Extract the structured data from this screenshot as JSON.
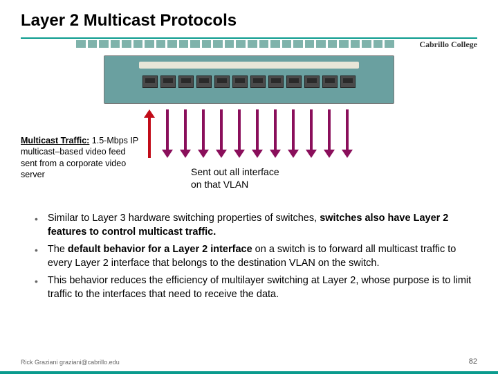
{
  "title": "Layer 2 Multicast Protocols",
  "brand": "Cabrillo College",
  "traffic": {
    "label": "Multicast Traffic:",
    "desc": " 1.5-Mbps IP multicast–based video feed sent from a corporate video server"
  },
  "sent_label_l1": "Sent out all interface",
  "sent_label_l2": "on that VLAN",
  "bullets": [
    {
      "pre": "Similar to Layer 3 hardware switching properties of switches, ",
      "bold": "switches also have Layer 2 features to control multicast traffic.",
      "post": ""
    },
    {
      "pre": "The ",
      "bold": "default behavior for a Layer 2 interface",
      "post": " on a switch is to forward all multicast traffic to every Layer 2 interface that belongs to the destination VLAN on the switch."
    },
    {
      "pre": "",
      "bold": "",
      "post": "This behavior reduces the efficiency of multilayer switching at Layer 2, whose purpose is to limit traffic to the interfaces that need to receive the data."
    }
  ],
  "footer": {
    "left": "Rick Graziani  graziani@cabrillo.edu",
    "right": "82"
  }
}
